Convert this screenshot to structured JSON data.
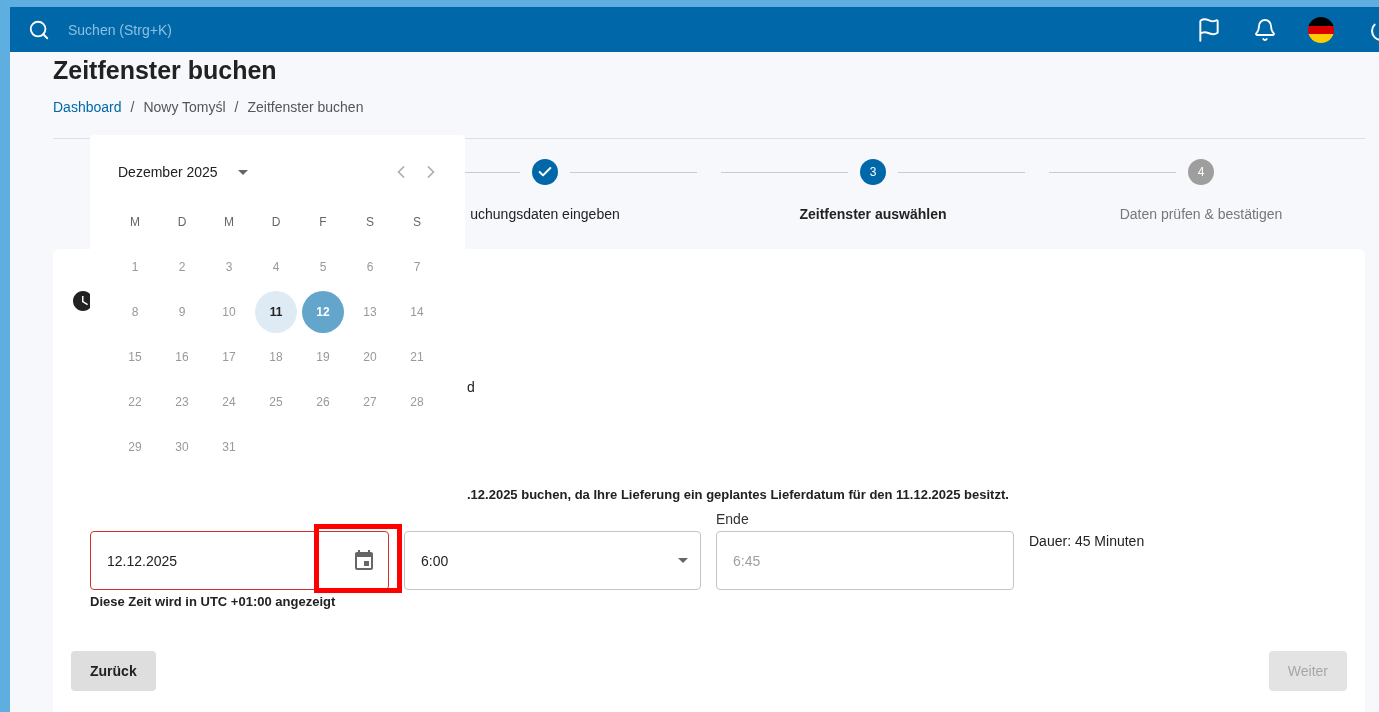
{
  "topbar": {
    "search": {
      "placeholder": "Suchen (Strg+K)"
    }
  },
  "page_title": "Zeitfenster buchen",
  "breadcrumb": [
    {
      "label": "Dashboard",
      "kind": "link"
    },
    {
      "label": "Nowy Tomyśl",
      "kind": "text"
    },
    {
      "label": "Zeitfenster buchen",
      "kind": "text"
    }
  ],
  "breadcrumb_separators": [
    "/",
    "/"
  ],
  "stepper": [
    {
      "label": "uchungsdaten eingeben",
      "kind": "done"
    },
    {
      "number": "3",
      "label": "Zeitfenster auswählen",
      "kind": "current"
    },
    {
      "number": "4",
      "label": "Daten prüfen & bestätigen",
      "kind": "upcoming"
    }
  ],
  "card": {
    "fragment": "d",
    "notice": ".12.2025 buchen, da Ihre Lieferung ein geplantes Lieferdatum für den 11.12.2025 besitzt.",
    "date_field": {
      "value": "12.12.2025",
      "error": true
    },
    "start_select": {
      "value": "6:00"
    },
    "end_field": {
      "label": "Ende",
      "value": "6:45",
      "disabled": true
    },
    "duration": "Dauer: 45 Minuten",
    "timezone_note": "Diese Zeit wird in UTC +01:00 angezeigt"
  },
  "buttons": [
    {
      "label": "Zurück",
      "disabled": false
    },
    {
      "label": "Weiter",
      "disabled": true
    }
  ],
  "datepicker": {
    "month": "Dezember 2025",
    "weekdays": [
      "M",
      "D",
      "M",
      "D",
      "F",
      "S",
      "S"
    ],
    "days": [
      {
        "label": "1",
        "selected": false,
        "today": false
      },
      {
        "label": "2",
        "selected": false,
        "today": false
      },
      {
        "label": "3",
        "selected": false,
        "today": false
      },
      {
        "label": "4",
        "selected": false,
        "today": false
      },
      {
        "label": "5",
        "selected": false,
        "today": false
      },
      {
        "label": "6",
        "selected": false,
        "today": false
      },
      {
        "label": "7",
        "selected": false,
        "today": false
      },
      {
        "label": "8",
        "selected": false,
        "today": false
      },
      {
        "label": "9",
        "selected": false,
        "today": false
      },
      {
        "label": "10",
        "selected": false,
        "today": false
      },
      {
        "label": "11",
        "selected": false,
        "today": true
      },
      {
        "label": "12",
        "selected": true,
        "today": false
      },
      {
        "label": "13",
        "selected": false,
        "today": false
      },
      {
        "label": "14",
        "selected": false,
        "today": false
      },
      {
        "label": "15",
        "selected": false,
        "today": false
      },
      {
        "label": "16",
        "selected": false,
        "today": false
      },
      {
        "label": "17",
        "selected": false,
        "today": false
      },
      {
        "label": "18",
        "selected": false,
        "today": false
      },
      {
        "label": "19",
        "selected": false,
        "today": false
      },
      {
        "label": "20",
        "selected": false,
        "today": false
      },
      {
        "label": "21",
        "selected": false,
        "today": false
      },
      {
        "label": "22",
        "selected": false,
        "today": false
      },
      {
        "label": "23",
        "selected": false,
        "today": false
      },
      {
        "label": "24",
        "selected": false,
        "today": false
      },
      {
        "label": "25",
        "selected": false,
        "today": false
      },
      {
        "label": "26",
        "selected": false,
        "today": false
      },
      {
        "label": "27",
        "selected": false,
        "today": false
      },
      {
        "label": "28",
        "selected": false,
        "today": false
      },
      {
        "label": "29",
        "selected": false,
        "today": false
      },
      {
        "label": "30",
        "selected": false,
        "today": false
      },
      {
        "label": "31",
        "selected": false,
        "today": false
      }
    ]
  }
}
